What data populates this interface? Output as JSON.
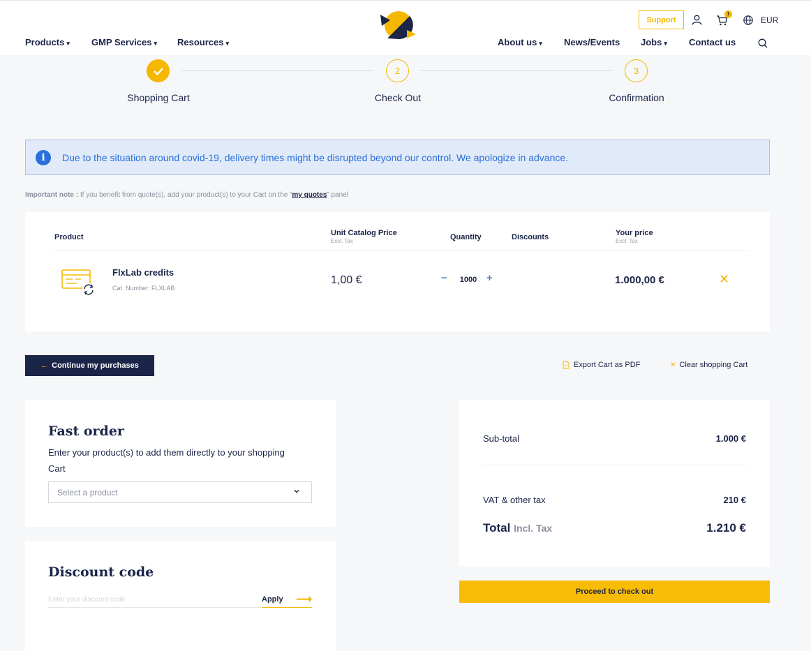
{
  "header": {
    "nav_left": [
      {
        "label": "Products",
        "caret": "▾"
      },
      {
        "label": "GMP Services",
        "caret": "▾"
      },
      {
        "label": "Resources",
        "caret": "▾"
      }
    ],
    "nav_right": [
      {
        "label": "About us",
        "caret": "▾"
      },
      {
        "label": "News/Events",
        "caret": ""
      },
      {
        "label": "Jobs",
        "caret": "▾"
      },
      {
        "label": "Contact us",
        "caret": ""
      }
    ],
    "support_label": "Support",
    "cart_count": "1",
    "currency": "EUR",
    "icons": [
      "user-icon",
      "cart-icon",
      "globe-icon",
      "search-icon"
    ]
  },
  "steps": [
    {
      "number": "",
      "label": "Shopping Cart",
      "status": "done"
    },
    {
      "number": "2",
      "label": "Check Out",
      "status": "pending"
    },
    {
      "number": "3",
      "label": "Confirmation",
      "status": "pending"
    }
  ],
  "alert": {
    "icon": "info-icon",
    "text": "Due to the situation around covid-19, delivery times might be disrupted beyond our control. We apologize in advance."
  },
  "note": {
    "bold": "Important note :",
    "text_before": " If you benefit from quote(s), add your product(s) to your Cart on the “",
    "link": "my quotes",
    "text_after": "” panel"
  },
  "cart": {
    "headers": {
      "product": "Product",
      "unit_price": "Unit Catalog Price",
      "unit_price_sub": "Excl. Tax",
      "quantity": "Quantity",
      "discounts": "Discounts",
      "your_price": "Your price",
      "your_price_sub": "Excl. Tax"
    },
    "items": [
      {
        "name": "FlxLab credits",
        "cat_number": "Cat. Number: FLXLAB",
        "unit_price": "1,00 €",
        "quantity": "1000",
        "your_price": "1.000,00 €"
      }
    ]
  },
  "actions": {
    "continue_arrow": "←",
    "continue": "Continue my purchases",
    "export_pdf": "Export Cart as PDF",
    "clear_cart": "Clear shopping Cart"
  },
  "fast_order": {
    "title": "Fast order",
    "description": "Enter your product(s) to add them directly to your shopping Cart",
    "select_placeholder": "Select a product"
  },
  "discount": {
    "title": "Discount code",
    "placeholder": "Enter your discount code",
    "apply": "Apply",
    "apply_arrow": "⟶"
  },
  "summary": {
    "subtotal_label": "Sub-total",
    "subtotal_value": "1.000 €",
    "vat_label": "VAT & other tax",
    "vat_value": "210 €",
    "total_label": "Total",
    "total_incl": "Incl. Tax",
    "total_value": "1.210 €",
    "checkout": "Proceed to check out"
  },
  "colors": {
    "navy": "#1b2548",
    "yellow": "#f5b800",
    "alert_blue": "#2a6fdb",
    "alert_bg": "#e0eaf8"
  }
}
